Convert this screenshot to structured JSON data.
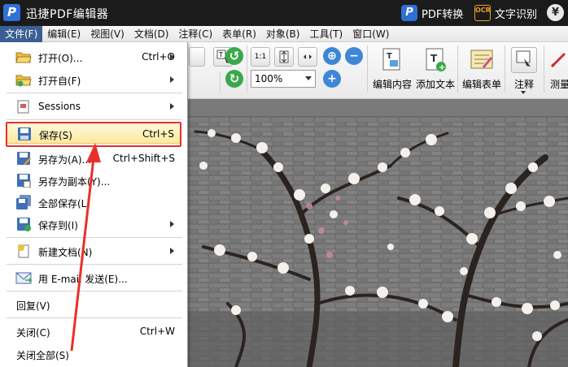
{
  "app": {
    "title": "迅捷PDF编辑器",
    "logo_letter": "P",
    "pdf_convert": "PDF转换",
    "ocr_label": "文字识别",
    "ocr_badge": "OCR",
    "vip_symbol": "¥"
  },
  "menubar": [
    "文件(F)",
    "编辑(E)",
    "视图(V)",
    "文档(D)",
    "注释(C)",
    "表单(R)",
    "对象(B)",
    "工具(T)",
    "窗口(W)"
  ],
  "toolbar": {
    "zoom_value": "100%",
    "page_btn_label": "1:1",
    "buttons": {
      "edit_content": "编辑内容",
      "add_text": "添加文本",
      "edit_form": "编辑表单",
      "annotate": "注释",
      "measure": "测量"
    }
  },
  "file_menu": {
    "items": [
      {
        "label": "打开(O)...",
        "shortcut": "Ctrl+O",
        "submenu": true,
        "icon": "folder-open-icon"
      },
      {
        "label": "打开自(F)",
        "shortcut": "",
        "submenu": true,
        "icon": "folder-open-from-icon"
      },
      {
        "label": "Sessions",
        "shortcut": "",
        "submenu": true,
        "icon": "sessions-icon"
      },
      {
        "label": "保存(S)",
        "shortcut": "Ctrl+S",
        "submenu": false,
        "icon": "save-icon"
      },
      {
        "label": "另存为(A)...",
        "shortcut": "Ctrl+Shift+S",
        "submenu": false,
        "icon": "save-as-icon"
      },
      {
        "label": "另存为副本(Y)...",
        "shortcut": "",
        "submenu": false,
        "icon": "save-copy-icon"
      },
      {
        "label": "全部保存(L)",
        "shortcut": "",
        "submenu": false,
        "icon": "save-all-icon"
      },
      {
        "label": "保存到(I)",
        "shortcut": "",
        "submenu": true,
        "icon": "save-to-icon"
      },
      {
        "label": "新建文档(N)",
        "shortcut": "",
        "submenu": true,
        "icon": "new-document-icon"
      },
      {
        "label": "用 E-mail 发送(E)...",
        "shortcut": "",
        "submenu": false,
        "icon": "email-icon"
      },
      {
        "label": "回复(V)",
        "shortcut": "",
        "submenu": false,
        "icon": ""
      },
      {
        "label": "关闭(C)",
        "shortcut": "Ctrl+W",
        "submenu": false,
        "icon": ""
      },
      {
        "label": "关闭全部(S)",
        "shortcut": "",
        "submenu": false,
        "icon": ""
      }
    ]
  },
  "colors": {
    "menu_active": "#3b5f93",
    "highlight_border": "#e8302a",
    "accent_blue": "#2f6fd8"
  }
}
